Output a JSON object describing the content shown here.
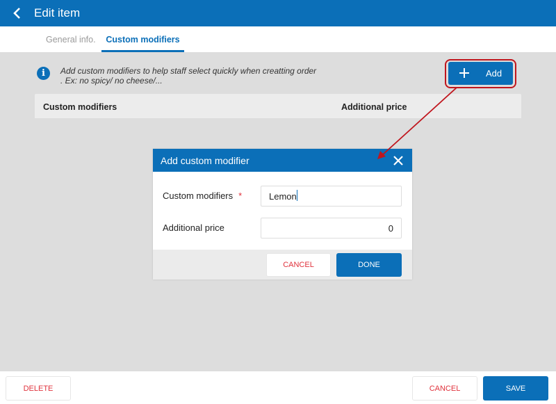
{
  "header": {
    "title": "Edit item",
    "back_icon": "chevron-left-icon"
  },
  "tabs": [
    {
      "label": "General info.",
      "active": false
    },
    {
      "label": "Custom modifiers",
      "active": true
    }
  ],
  "info": {
    "icon": "info-icon",
    "line1": "Add custom modifiers to help staff select quickly when creatting order",
    "line2": ". Ex: no spicy/ no cheese/..."
  },
  "add_button": {
    "label": "Add",
    "icon": "plus-icon"
  },
  "table": {
    "columns": [
      "Custom modifiers",
      "Additional price"
    ],
    "rows": []
  },
  "dialog": {
    "title": "Add custom modifier",
    "close_icon": "close-icon",
    "fields": [
      {
        "label": "Custom modifiers",
        "required_mark": "*",
        "value": "Lemon"
      },
      {
        "label": "Additional price",
        "value": "0"
      }
    ],
    "cancel_label": "CANCEL",
    "done_label": "DONE"
  },
  "footer": {
    "delete_label": "DELETE",
    "cancel_label": "CANCEL",
    "save_label": "SAVE"
  },
  "colors": {
    "primary": "#0b6fb8",
    "danger": "#e0323c",
    "annotation": "#c0151d",
    "background": "#dddddd"
  }
}
